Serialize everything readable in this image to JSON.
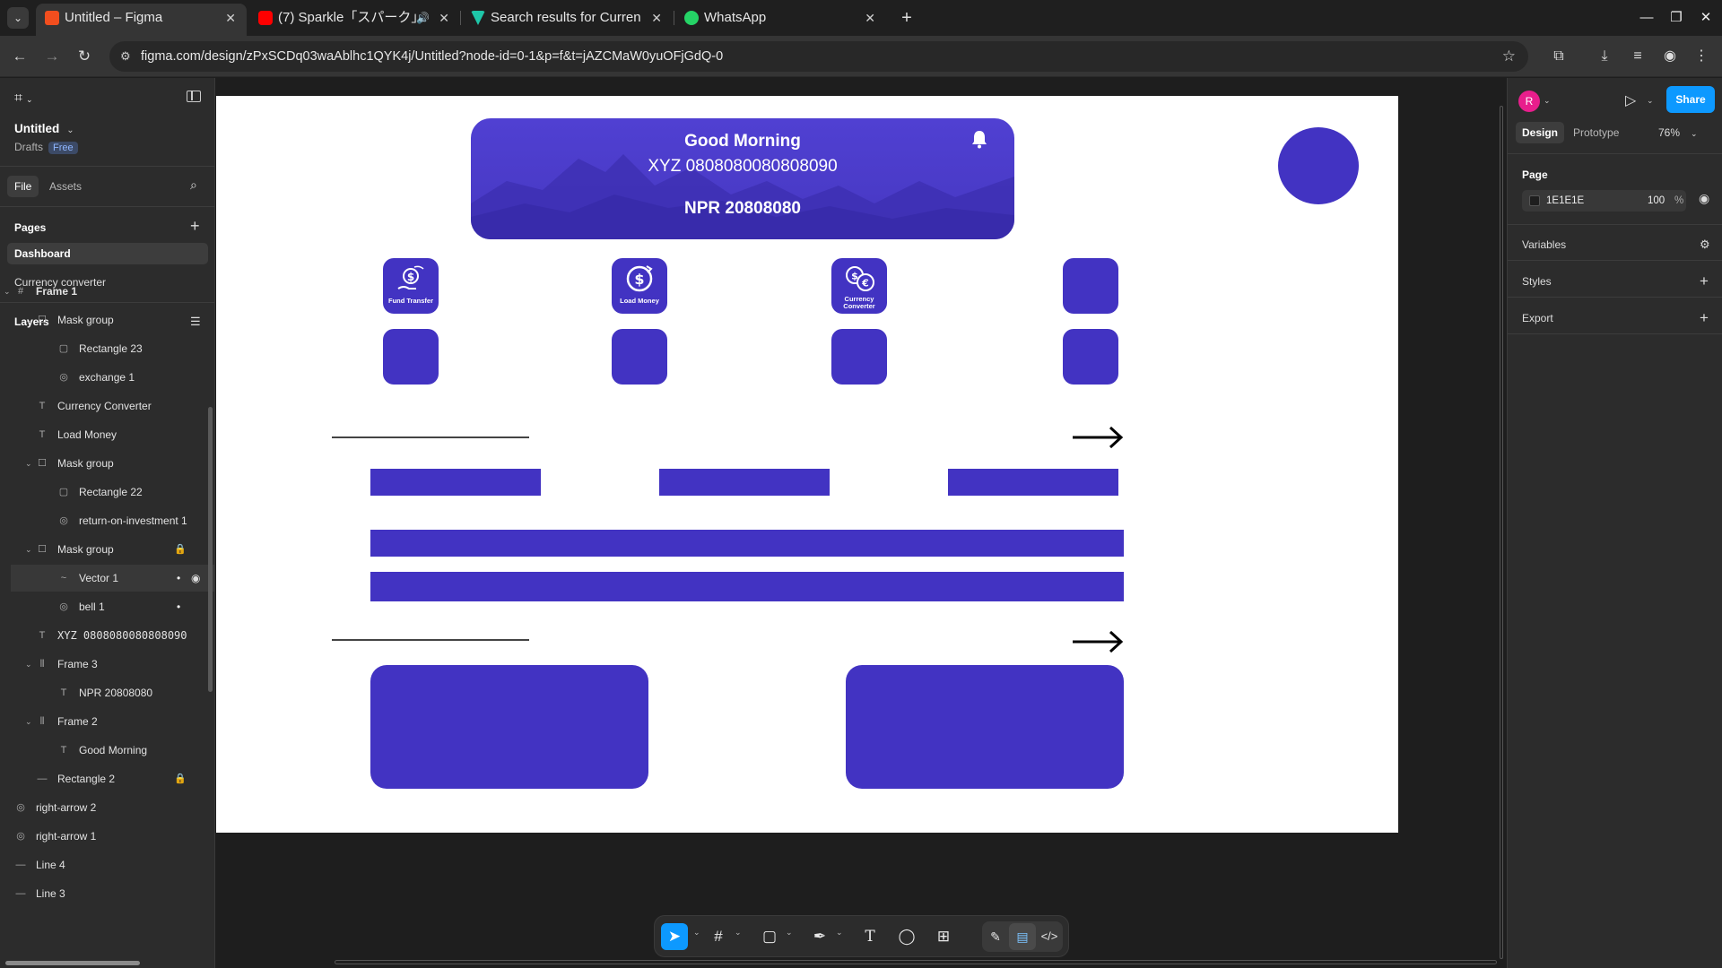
{
  "browser": {
    "tabs": [
      {
        "title": "Untitled – Figma",
        "active": true,
        "favicon_color": "#f24e1e"
      },
      {
        "title": "(7) Sparkle「スパーク」",
        "active": false,
        "favicon_color": "#ff0000"
      },
      {
        "title": "Search results for Curren",
        "active": false,
        "favicon_color": "#1ec6a8"
      },
      {
        "title": "WhatsApp",
        "active": false,
        "favicon_color": "#25d366"
      }
    ],
    "url": "figma.com/design/zPxSCDq03waAblhc1QYK4j/Untitled?node-id=0-1&p=f&t=jAZCMaW0yuOFjGdQ-0"
  },
  "left_panel": {
    "file_title": "Untitled",
    "drafts_label": "Drafts",
    "plan_badge": "Free",
    "tabs": [
      "File",
      "Assets"
    ],
    "pages_title": "Pages",
    "pages": [
      {
        "name": "Dashboard",
        "active": true
      },
      {
        "name": "Currency converter",
        "active": false
      }
    ],
    "layers_title": "Layers",
    "layers": [
      {
        "name": "Frame 1",
        "icon": "frame-icon",
        "depth": 0,
        "chevron": true
      },
      {
        "name": "Mask group",
        "icon": "mask-icon",
        "depth": 1,
        "chevron": true
      },
      {
        "name": "Rectangle 23",
        "icon": "rectangle-icon",
        "depth": 2
      },
      {
        "name": "exchange 1",
        "icon": "image-icon",
        "depth": 2
      },
      {
        "name": "Currency Converter",
        "icon": "text-icon",
        "depth": 1
      },
      {
        "name": "Load Money",
        "icon": "text-icon",
        "depth": 1
      },
      {
        "name": "Mask group",
        "icon": "mask-icon",
        "depth": 1,
        "chevron": true
      },
      {
        "name": "Rectangle 22",
        "icon": "rectangle-icon",
        "depth": 2
      },
      {
        "name": "return-on-investment 1",
        "icon": "image-icon",
        "depth": 2
      },
      {
        "name": "Mask group",
        "icon": "mask-icon",
        "depth": 1,
        "chevron": true,
        "locked": true
      },
      {
        "name": "Vector 1",
        "icon": "vector-icon",
        "depth": 2,
        "selected": true
      },
      {
        "name": "bell 1",
        "icon": "image-icon",
        "depth": 2
      },
      {
        "name": "XYZ 0808080080808090",
        "icon": "text-icon",
        "depth": 1
      },
      {
        "name": "Frame 3",
        "icon": "autolayout-icon",
        "depth": 1,
        "chevron": true
      },
      {
        "name": "NPR 20808080",
        "icon": "text-icon",
        "depth": 2
      },
      {
        "name": "Frame 2",
        "icon": "autolayout-icon",
        "depth": 1,
        "chevron": true
      },
      {
        "name": "Good Morning",
        "icon": "text-icon",
        "depth": 2
      },
      {
        "name": "Rectangle 2",
        "icon": "line-icon",
        "depth": 1,
        "locked": true
      },
      {
        "name": "right-arrow 2",
        "icon": "image-icon",
        "depth": 0
      },
      {
        "name": "right-arrow 1",
        "icon": "image-icon",
        "depth": 0
      },
      {
        "name": "Line 4",
        "icon": "line-icon",
        "depth": 0
      },
      {
        "name": "Line 3",
        "icon": "line-icon",
        "depth": 0
      }
    ]
  },
  "canvas": {
    "greeting": "Good Morning",
    "account": "XYZ 0808080080808090",
    "balance": "NPR 20808080",
    "icon_labels": [
      "Fund Transfer",
      "Load Money",
      "Currency Converter"
    ],
    "accent": "#4233c2",
    "frame_bg": "#ffffff"
  },
  "toolbar": {
    "tools": [
      "move-tool",
      "frame-tool",
      "shape-tool",
      "pen-tool",
      "text-tool",
      "comment-tool",
      "actions-tool",
      "draw-mode",
      "design-mode",
      "dev-mode"
    ]
  },
  "right_panel": {
    "avatar_letter": "R",
    "share_label": "Share",
    "tabs": [
      "Design",
      "Prototype"
    ],
    "zoom": "76%",
    "page_section": "Page",
    "page_color": "1E1E1E",
    "page_opacity": "100",
    "page_opacity_unit": "%",
    "variables_label": "Variables",
    "styles_label": "Styles",
    "export_label": "Export"
  },
  "help_label": "?"
}
